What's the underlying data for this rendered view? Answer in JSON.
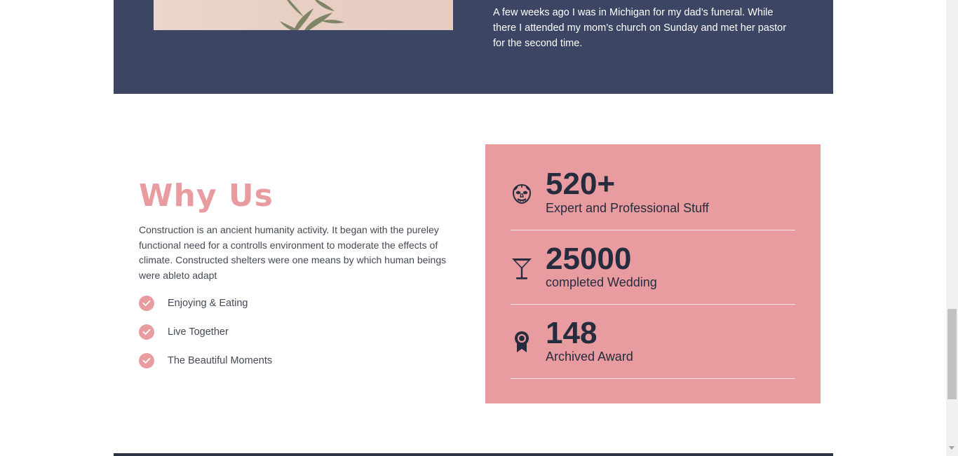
{
  "story": {
    "text": "A few weeks ago I was in Michigan for my dad’s funeral. While there I attended my mom’s church on Sunday and met her pastor for the second time."
  },
  "why_us": {
    "title": "Why Us",
    "description": "Construction is an ancient humanity activity. It began with the pureley functional need for a controlls environment to moderate the effects of climate. Constructed shelters were one means by which human beings were ableto adapt",
    "features": [
      {
        "label": "Enjoying & Eating",
        "icon": "check-circle-icon"
      },
      {
        "label": "Live Together",
        "icon": "check-circle-icon"
      },
      {
        "label": "The Beautiful Moments",
        "icon": "check-circle-icon"
      }
    ]
  },
  "stats": [
    {
      "number": "520+",
      "label": "Expert and Professional Stuff",
      "icon": "mask-icon"
    },
    {
      "number": "25000",
      "label": "completed Wedding",
      "icon": "cocktail-glass-icon"
    },
    {
      "number": "148",
      "label": "Archived Award",
      "icon": "award-ribbon-icon"
    }
  ],
  "colors": {
    "accent_pink": "#e89ca0",
    "navy_band": "#3c4664",
    "dark_text": "#252c3e"
  }
}
